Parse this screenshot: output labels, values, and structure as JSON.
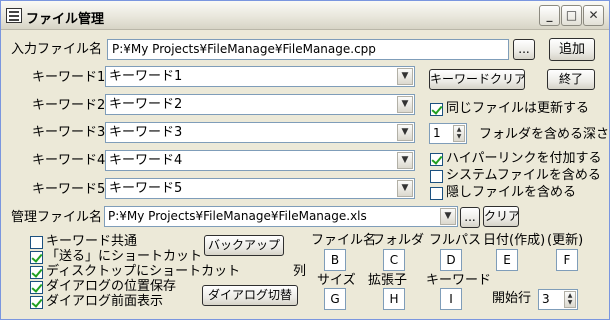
{
  "window": {
    "title": "ファイル管理",
    "minimize": "_",
    "maximize": "□",
    "close": "✕"
  },
  "input_file": {
    "label": "入力ファイル名",
    "value": "P:¥My Projects¥FileManage¥FileManage.cpp",
    "browse": "...",
    "add": "追加"
  },
  "keywords": [
    {
      "label": "キーワード1",
      "value": "キーワード1"
    },
    {
      "label": "キーワード2",
      "value": "キーワード2"
    },
    {
      "label": "キーワード3",
      "value": "キーワード3"
    },
    {
      "label": "キーワード4",
      "value": "キーワード4"
    },
    {
      "label": "キーワード5",
      "value": "キーワード5"
    }
  ],
  "buttons": {
    "keyword_clear": "キーワードクリア",
    "exit": "終了",
    "backup": "バックアップ",
    "dialog_toggle": "ダイアログ切替",
    "manage_clear": "クリア",
    "manage_browse": "..."
  },
  "options": {
    "update_same": {
      "label": "同じファイルは更新する",
      "checked": true
    },
    "folder_depth": {
      "label": "フォルダを含める深さ",
      "value": "1"
    },
    "hyperlink": {
      "label": "ハイパーリンクを付加する",
      "checked": true
    },
    "system_files": {
      "label": "システムファイルを含める",
      "checked": false
    },
    "hidden_files": {
      "label": "隠しファイルを含める",
      "checked": false
    }
  },
  "manage_file": {
    "label": "管理ファイル名",
    "value": "P:¥My Projects¥FileManage¥FileManage.xls"
  },
  "bottom_checks": [
    {
      "label": "キーワード共通",
      "checked": false
    },
    {
      "label": "「送る」にショートカット",
      "checked": true
    },
    {
      "label": "ディスクトップにショートカット",
      "checked": true
    },
    {
      "label": "ダイアログの位置保存",
      "checked": true
    },
    {
      "label": "ダイアログ前面表示",
      "checked": true
    }
  ],
  "columns": {
    "title": "列",
    "file_name": {
      "label": "ファイル名",
      "value": "B"
    },
    "folder": {
      "label": "フォルダ",
      "value": "C"
    },
    "full_path": {
      "label": "フルパス",
      "value": "D"
    },
    "date_created": {
      "label": "日付(作成)",
      "value": "E"
    },
    "date_updated": {
      "label": "(更新)",
      "value": "F"
    },
    "size": {
      "label": "サイズ",
      "value": "G"
    },
    "extension": {
      "label": "拡張子",
      "value": "H"
    },
    "keyword": {
      "label": "キーワード",
      "value": "I"
    },
    "start_row": {
      "label": "開始行",
      "value": "3"
    }
  }
}
